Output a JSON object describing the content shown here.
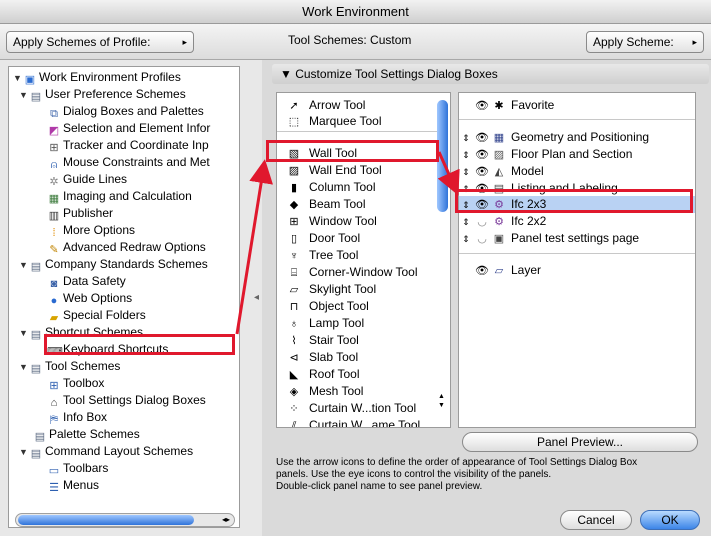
{
  "window": {
    "title": "Work Environment"
  },
  "topbar": {
    "apply_profile_label": "Apply Schemes of Profile:",
    "tool_schemes_label": "Tool Schemes: Custom",
    "apply_scheme_label": "Apply Scheme:"
  },
  "tree": {
    "items": [
      {
        "label": "Work Environment Profiles",
        "icon": "profiles-icon",
        "twisty": "▼"
      },
      {
        "label": "User Preference Schemes",
        "icon": "scheme-folder-icon",
        "twisty": "▼"
      },
      {
        "label": "Dialog Boxes and Palettes",
        "icon": "dialog-icon",
        "twisty": ""
      },
      {
        "label": "Selection and Element Infor",
        "icon": "selection-icon",
        "twisty": ""
      },
      {
        "label": "Tracker and Coordinate Inp",
        "icon": "tracker-icon",
        "twisty": ""
      },
      {
        "label": "Mouse Constraints and Met",
        "icon": "mouse-icon",
        "twisty": ""
      },
      {
        "label": "Guide Lines",
        "icon": "guide-lines-icon",
        "twisty": ""
      },
      {
        "label": "Imaging and Calculation",
        "icon": "imaging-icon",
        "twisty": ""
      },
      {
        "label": "Publisher",
        "icon": "publisher-icon",
        "twisty": ""
      },
      {
        "label": "More Options",
        "icon": "more-options-icon",
        "twisty": ""
      },
      {
        "label": "Advanced Redraw Options",
        "icon": "redraw-icon",
        "twisty": ""
      },
      {
        "label": "Company Standards Schemes",
        "icon": "company-icon",
        "twisty": "▼"
      },
      {
        "label": "Data Safety",
        "icon": "data-safety-icon",
        "twisty": ""
      },
      {
        "label": "Web Options",
        "icon": "web-icon",
        "twisty": ""
      },
      {
        "label": "Special Folders",
        "icon": "folder-icon",
        "twisty": ""
      },
      {
        "label": "Shortcut Schemes",
        "icon": "shortcut-icon",
        "twisty": "▼"
      },
      {
        "label": "Keyboard Shortcuts",
        "icon": "keyboard-icon",
        "twisty": ""
      },
      {
        "label": "Tool Schemes",
        "icon": "tool-schemes-icon",
        "twisty": "▼"
      },
      {
        "label": "Toolbox",
        "icon": "toolbox-icon",
        "twisty": ""
      },
      {
        "label": "Tool Settings Dialog Boxes",
        "icon": "tool-settings-icon",
        "twisty": ""
      },
      {
        "label": "Info Box",
        "icon": "info-box-icon",
        "twisty": ""
      },
      {
        "label": "Palette Schemes",
        "icon": "palette-icon",
        "twisty": ""
      },
      {
        "label": "Command Layout Schemes",
        "icon": "command-icon",
        "twisty": "▼"
      },
      {
        "label": "Toolbars",
        "icon": "toolbars-icon",
        "twisty": ""
      },
      {
        "label": "Menus",
        "icon": "menus-icon",
        "twisty": ""
      }
    ]
  },
  "section": {
    "title": "Customize Tool Settings Dialog Boxes"
  },
  "tools": {
    "items": [
      "Arrow Tool",
      "Marquee Tool",
      "Wall Tool",
      "Wall End Tool",
      "Column Tool",
      "Beam Tool",
      "Window Tool",
      "Door Tool",
      "Tree Tool",
      "Corner-Window Tool",
      "Skylight Tool",
      "Object Tool",
      "Lamp Tool",
      "Stair Tool",
      "Slab Tool",
      "Roof Tool",
      "Mesh Tool",
      "Curtain W...tion Tool",
      "Curtain W...ame Tool"
    ],
    "selected": "Wall Tool"
  },
  "panels": {
    "items": [
      {
        "label": "Favorite",
        "updown": "",
        "eye": "👁"
      },
      {
        "label": "Geometry and Positioning",
        "updown": "⇕",
        "eye": "👁"
      },
      {
        "label": "Floor Plan and Section",
        "updown": "⇕",
        "eye": "👁"
      },
      {
        "label": "Model",
        "updown": "⇕",
        "eye": "👁"
      },
      {
        "label": "Listing and Labeling",
        "updown": "⇕",
        "eye": "👁"
      },
      {
        "label": "Ifc 2x3",
        "updown": "⇕",
        "eye": "👁"
      },
      {
        "label": "Ifc 2x2",
        "updown": "⇕",
        "eye": "◡"
      },
      {
        "label": "Panel test settings page",
        "updown": "⇕",
        "eye": "◡"
      },
      {
        "label": "Layer",
        "updown": "",
        "eye": "👁"
      }
    ],
    "selected": "Ifc 2x3"
  },
  "buttons": {
    "panel_preview": "Panel Preview...",
    "cancel": "Cancel",
    "ok": "OK"
  },
  "help": {
    "line1": "Use the arrow icons to define the order of appearance of Tool Settings Dialog Box",
    "line2": "panels. Use the eye icons to control the visibility of the panels.",
    "line3": "Double-click panel name to see panel preview."
  },
  "colors": {
    "highlight": "#e0182d",
    "accent": "#2f73d9",
    "selection": "#b9d2f3"
  }
}
